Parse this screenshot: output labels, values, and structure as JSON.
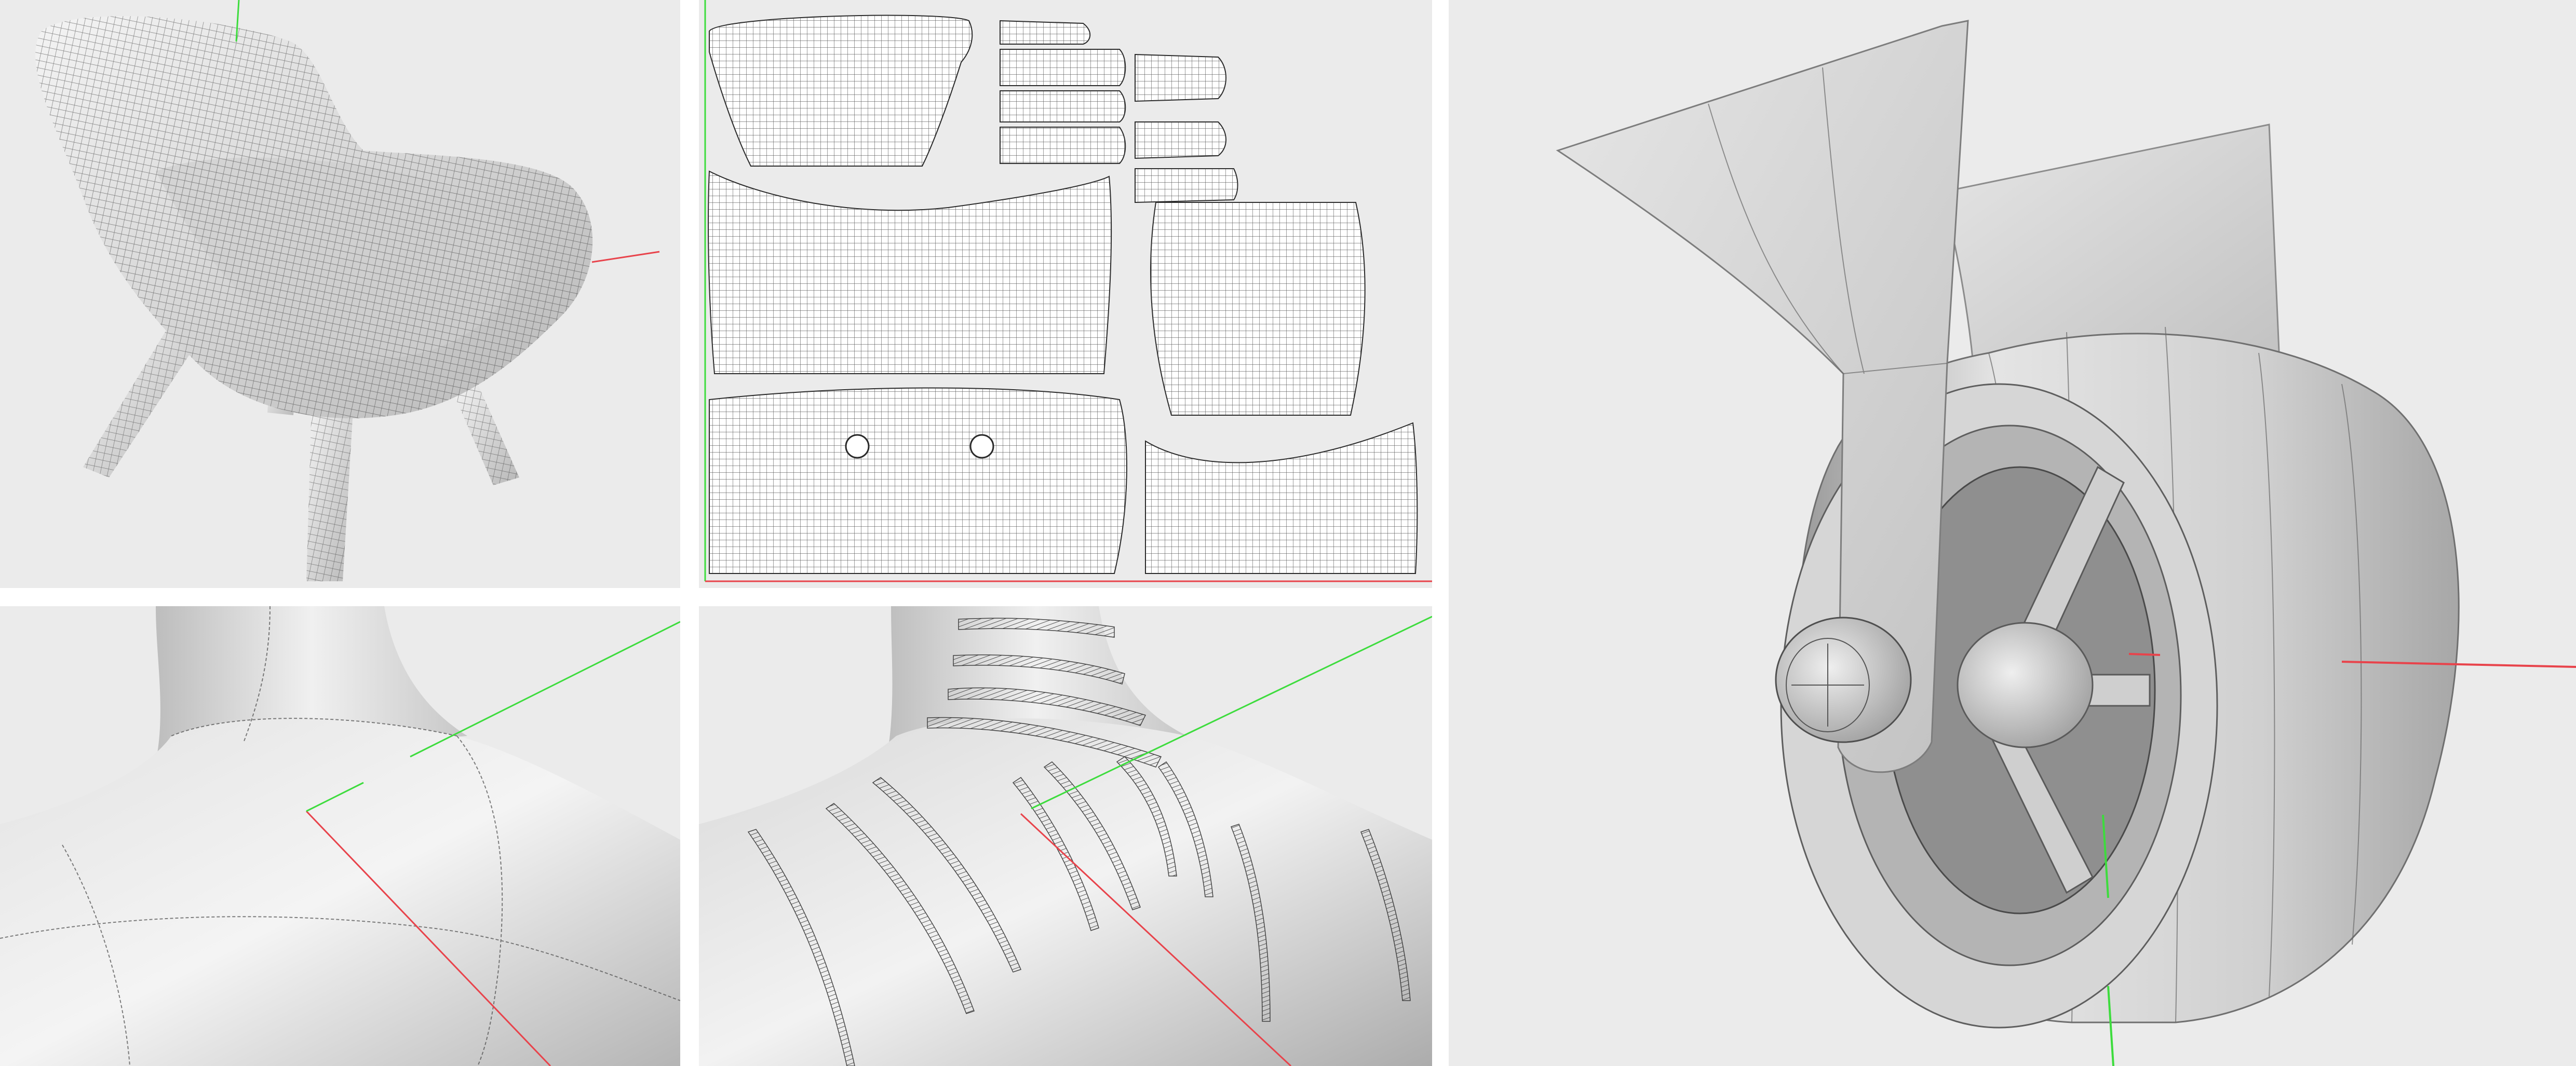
{
  "viewports": [
    {
      "id": "chair",
      "content": "wireframe-chair-model"
    },
    {
      "id": "uv",
      "content": "uv-layout-islands"
    },
    {
      "id": "surface",
      "content": "shaded-junction-surface"
    },
    {
      "id": "surface-ribs",
      "content": "junction-surface-with-cross-sections"
    },
    {
      "id": "wheel",
      "content": "caster-wheel-model"
    }
  ],
  "colors": {
    "background": "#ebebeb",
    "separator": "#ffffff",
    "axis_x": "#e8434b",
    "axis_y": "#3ddc3d",
    "mesh_line": "#2a2a2a",
    "shade_light": "#f2f2f2",
    "shade_dark": "#9c9c9c"
  }
}
